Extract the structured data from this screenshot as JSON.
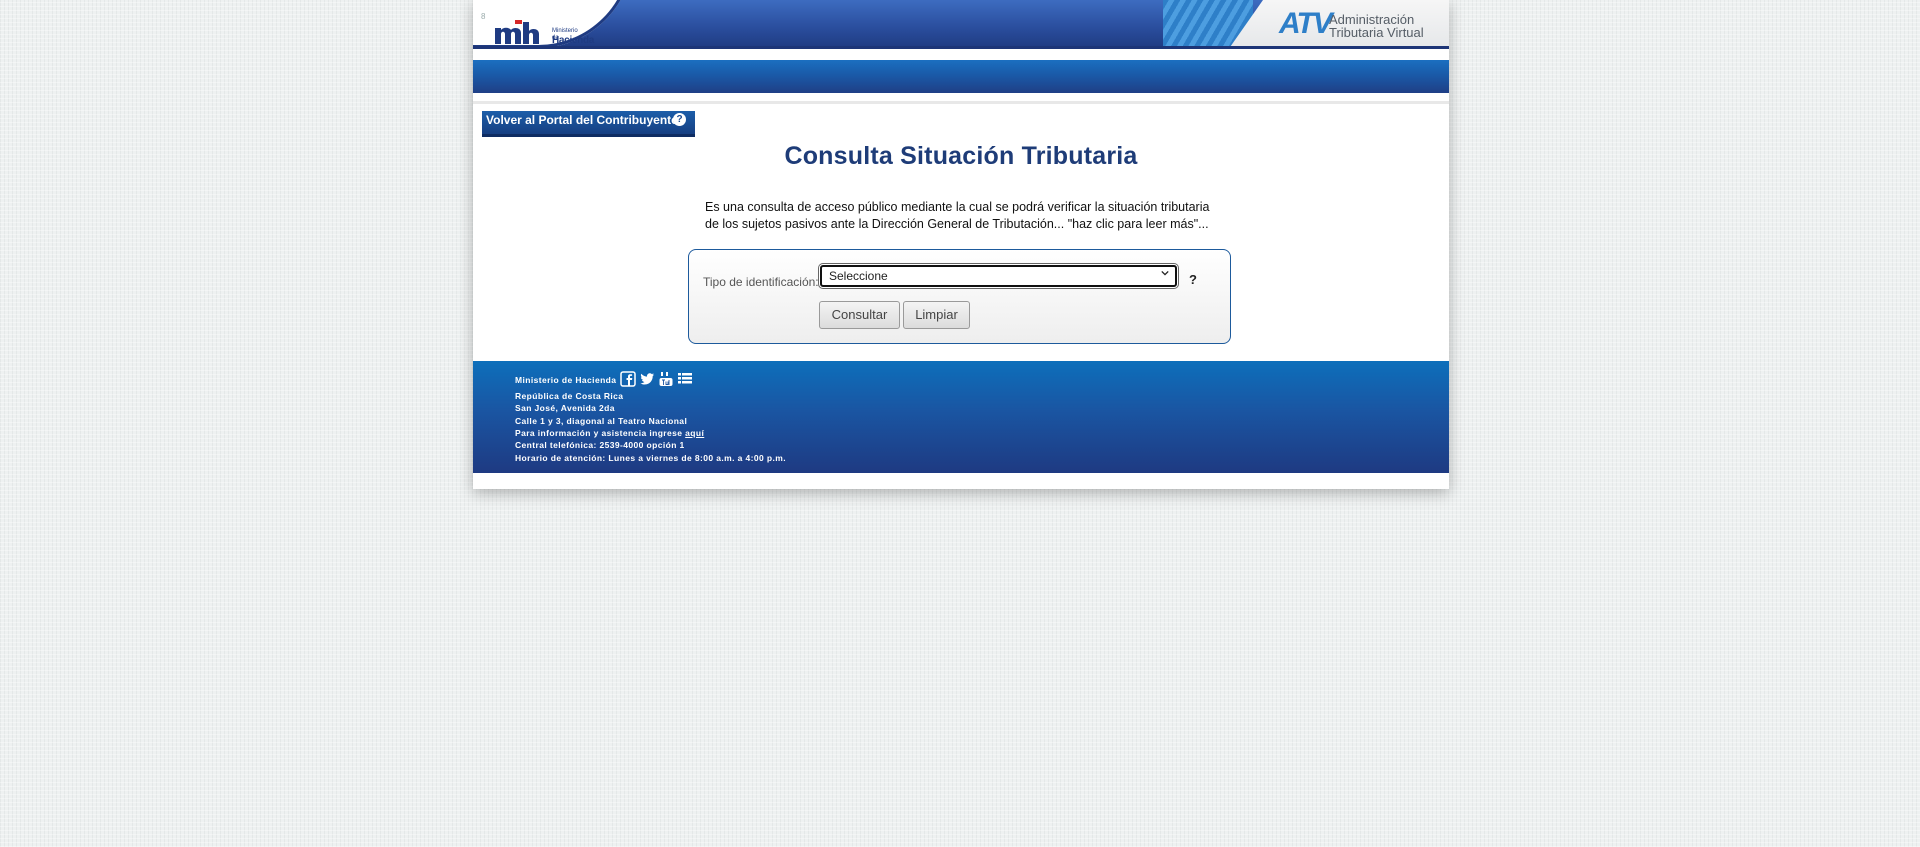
{
  "header": {
    "ministry_small": "Ministerio de",
    "ministry_name": "Hacienda",
    "atv_mark": "ATV",
    "atv_line1": "Administración",
    "atv_line2": "Tributaria Virtual",
    "tiny_mark": "8"
  },
  "back_link": {
    "label": "Volver al Portal del Contribuyente",
    "help": "?"
  },
  "main": {
    "title": "Consulta Situación Tributaria",
    "intro_line1": "Es una consulta de acceso público mediante la cual se podrá verificar la situación tributaria",
    "intro_line2": "de los sujetos pasivos ante la Dirección General de Tributación... \"haz clic para leer más\"..."
  },
  "form": {
    "id_type_label": "Tipo de identificación:",
    "id_type_selected": "Seleccione",
    "help": "?",
    "consult_label": "Consultar",
    "clear_label": "Limpiar"
  },
  "footer": {
    "ministry": "Ministerio de Hacienda",
    "country": "República de Costa Rica",
    "city": "San José, Avenida 2da",
    "address": "Calle 1 y 3, diagonal al Teatro Nacional",
    "info_prefix": "Para información y asistencia ingrese",
    "info_link": "aquí",
    "phone": "Central telefónica: 2539-4000 opción 1",
    "hours": "Horario de atención: Lunes a viernes de 8:00 a.m. a 4:00 p.m.",
    "social_icons": [
      "facebook-icon",
      "twitter-icon",
      "youtube-icon",
      "list-icon"
    ]
  },
  "colors": {
    "brand_blue": "#1e3c78",
    "nav_blue": "#1a5aa8",
    "footer_blue": "#0d6fbb"
  }
}
